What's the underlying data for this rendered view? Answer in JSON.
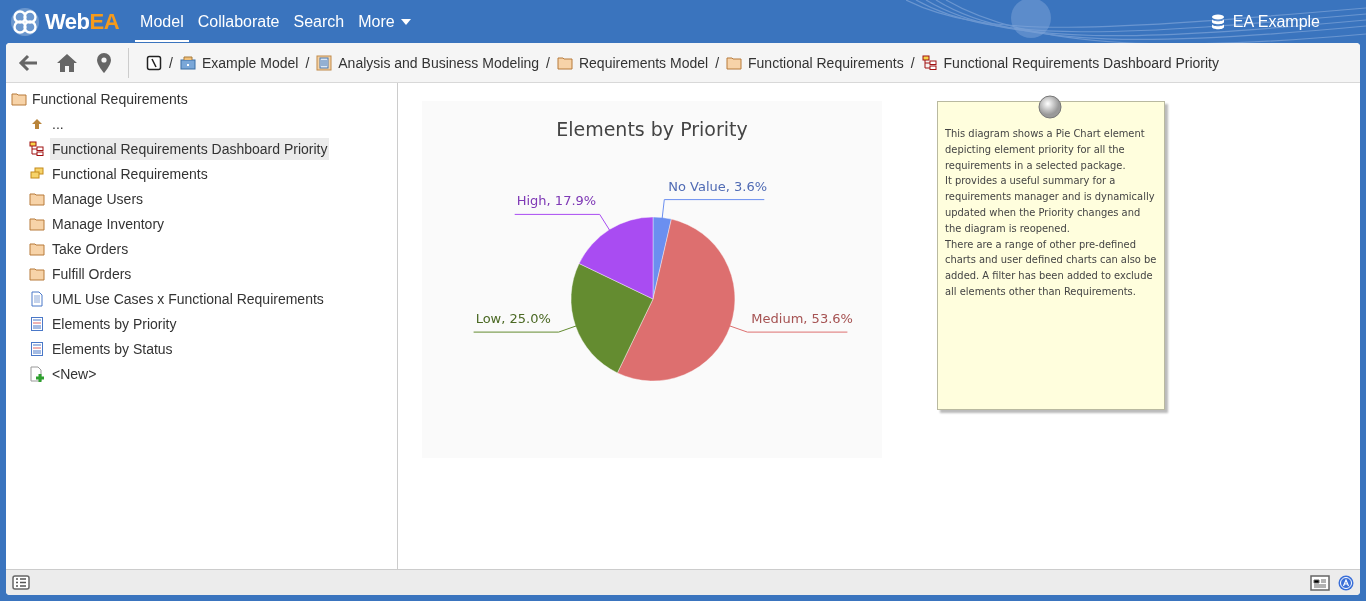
{
  "header": {
    "logo": {
      "text_1": "Web",
      "text_2": "EA"
    },
    "nav": [
      {
        "label": "Model",
        "selected": true,
        "kind": "link"
      },
      {
        "label": "Collaborate",
        "selected": false,
        "kind": "link"
      },
      {
        "label": "Search",
        "selected": false,
        "kind": "link"
      },
      {
        "label": "More",
        "selected": false,
        "kind": "dropdown"
      }
    ],
    "repository": "EA Example"
  },
  "breadcrumb": [
    {
      "kind": "root"
    },
    {
      "kind": "model",
      "separator": "/",
      "label": "Example Model"
    },
    {
      "kind": "view",
      "separator": "/",
      "label": "Analysis and Business Modeling"
    },
    {
      "kind": "folder",
      "separator": "/",
      "label": "Requirements Model"
    },
    {
      "kind": "folder",
      "separator": "/",
      "label": "Functional Requirements"
    },
    {
      "kind": "diagram",
      "separator": "/",
      "label": "Functional Requirements Dashboard Priority"
    }
  ],
  "tree": {
    "label": "Functional Requirements",
    "kind": "folder",
    "children": [
      {
        "label": "...",
        "kind": "up",
        "selected": false
      },
      {
        "label": "Functional Requirements Dashboard Priority",
        "kind": "diagram",
        "selected": true
      },
      {
        "label": "Functional Requirements",
        "kind": "element",
        "selected": false
      },
      {
        "label": "Manage Users",
        "kind": "folder",
        "selected": false
      },
      {
        "label": "Manage Inventory",
        "kind": "folder",
        "selected": false
      },
      {
        "label": "Take Orders",
        "kind": "folder",
        "selected": false
      },
      {
        "label": "Fulfill Orders",
        "kind": "folder",
        "selected": false
      },
      {
        "label": "UML Use Cases x Functional Requirements",
        "kind": "document",
        "selected": false
      },
      {
        "label": "Elements by Priority",
        "kind": "chart",
        "selected": false
      },
      {
        "label": "Elements by Status",
        "kind": "chart",
        "selected": false
      },
      {
        "label": "<New>",
        "kind": "new",
        "selected": false
      }
    ]
  },
  "diagram": {
    "chart_data": {
      "type": "pie",
      "title": "Elements by Priority",
      "values": [
        3.6,
        53.6,
        25.0,
        17.9
      ],
      "value_labels": [
        "No Value, 3.6%",
        "Medium, 53.6%",
        "Low, 25.0%",
        "High, 17.9%"
      ]
    },
    "note": {
      "paragraphs": [
        "This diagram shows a Pie Chart element depicting element priority for all the requirements in a selected package.",
        "It provides a useful summary for a requirements manager and is dynamically updated when the Priority changes and the diagram is reopened.",
        "There are a range of other pre-defined charts and user defined charts can also be added. A filter has been added to exclude all elements other than Requirements."
      ]
    }
  }
}
